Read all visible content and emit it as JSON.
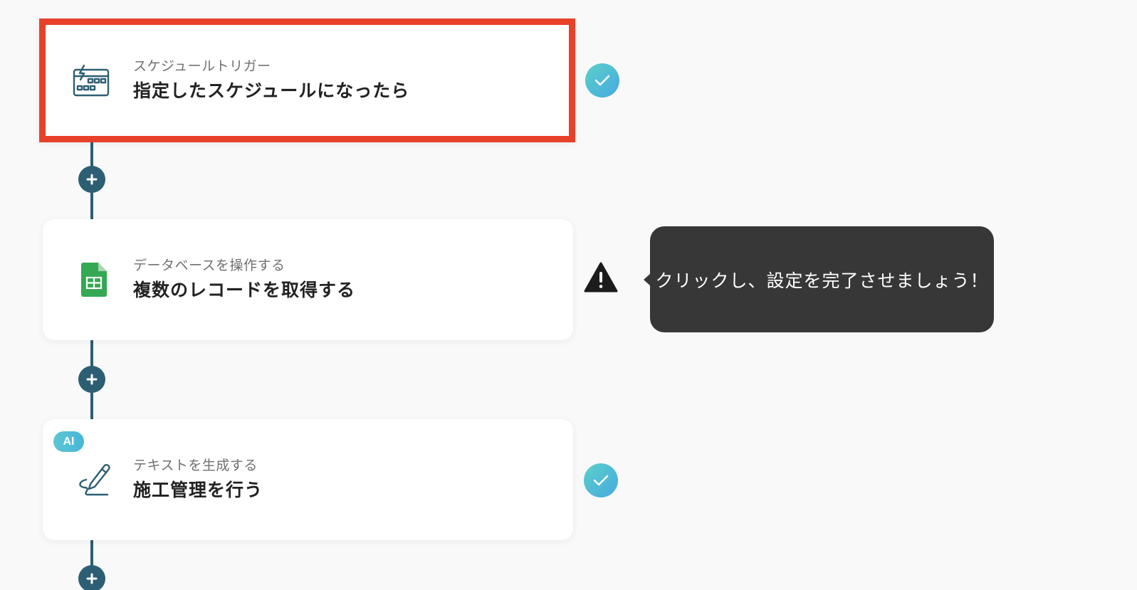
{
  "steps": [
    {
      "subtitle": "スケジュールトリガー",
      "title": "指定したスケジュールになったら",
      "icon": "schedule-trigger-icon",
      "status": "complete",
      "selected": true
    },
    {
      "subtitle": "データベースを操作する",
      "title": "複数のレコードを取得する",
      "icon": "google-sheets-icon",
      "status": "warning",
      "selected": false
    },
    {
      "subtitle": "テキストを生成する",
      "title": "施工管理を行う",
      "icon": "pen-icon",
      "status": "complete",
      "badge": "AI",
      "selected": false
    }
  ],
  "tooltip": {
    "text": "クリックし、設定を完了させましょう！"
  },
  "colors": {
    "connector": "#2d5f74",
    "selected_border": "#e8412a",
    "check_start": "#5cd0c9",
    "check_end": "#46a9e0",
    "tooltip_bg": "#373737",
    "sheets_green": "#34a853"
  }
}
